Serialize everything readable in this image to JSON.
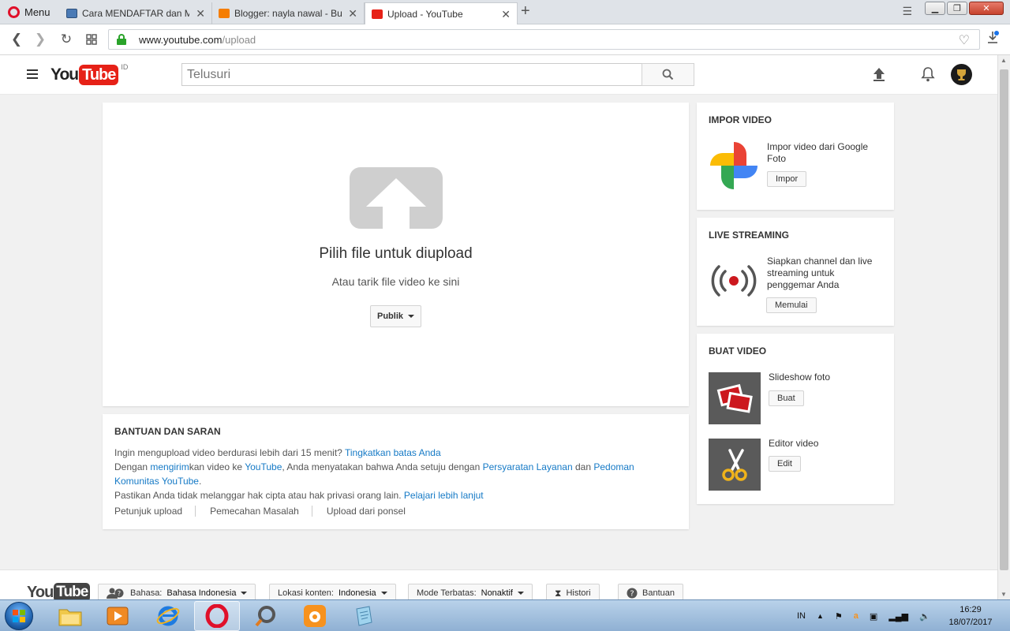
{
  "browser": {
    "menu_label": "Menu",
    "tabs": [
      {
        "label": "Cara MENDAFTAR dan ME",
        "favicon_color": "#4a7ab5"
      },
      {
        "label": "Blogger: nayla nawal - Bua",
        "favicon_color": "#f57d00"
      },
      {
        "label": "Upload - YouTube",
        "favicon_color": "#e62117"
      }
    ],
    "new_tab": "+",
    "url_host": "www.youtube.com",
    "url_path": "/upload"
  },
  "header": {
    "logo_you": "You",
    "logo_tube": "Tube",
    "region": "ID",
    "search_placeholder": "Telusuri"
  },
  "upload": {
    "title": "Pilih file untuk diupload",
    "subtitle": "Atau tarik file video ke sini",
    "privacy_label": "Publik"
  },
  "help": {
    "title": "BANTUAN DAN SARAN",
    "line1_text": "Ingin mengupload video berdurasi lebih dari 15 menit? ",
    "line1_link": "Tingkatkan batas Anda",
    "line2_a": "Dengan ",
    "line2_link1": "mengirim",
    "line2_b": "kan video ke ",
    "line2_link2": "YouTube",
    "line2_c": ", Anda menyatakan bahwa Anda setuju dengan ",
    "line2_link3": "Persyaratan Layanan",
    "line2_d": " dan ",
    "line2_link4": "Pedoman Komunitas YouTube",
    "line2_e": ".",
    "line3_text": "Pastikan Anda tidak melanggar hak cipta atau hak privasi orang lain. ",
    "line3_link": "Pelajari lebih lanjut",
    "links": [
      "Petunjuk upload",
      "Pemecahan Masalah",
      "Upload dari ponsel"
    ]
  },
  "import": {
    "title": "IMPOR VIDEO",
    "text": "Impor video dari Google Foto",
    "button": "Impor"
  },
  "live": {
    "title": "LIVE STREAMING",
    "text": "Siapkan channel dan live streaming untuk penggemar Anda",
    "button": "Memulai"
  },
  "create": {
    "title": "BUAT VIDEO",
    "slideshow_label": "Slideshow foto",
    "slideshow_button": "Buat",
    "editor_label": "Editor video",
    "editor_button": "Edit"
  },
  "footer": {
    "logo_you": "You",
    "logo_tube": "Tube",
    "language_label": "Bahasa:",
    "language_value": "Bahasa Indonesia",
    "location_label": "Lokasi konten:",
    "location_value": "Indonesia",
    "restricted_label": "Mode Terbatas:",
    "restricted_value": "Nonaktif",
    "history": "Histori",
    "help": "Bantuan"
  },
  "taskbar": {
    "lang": "IN",
    "time": "16:29",
    "date": "18/07/2017"
  },
  "colors": {
    "youtube_red": "#e62117",
    "link_blue": "#167ac6",
    "secure_green": "#2aa32a"
  }
}
